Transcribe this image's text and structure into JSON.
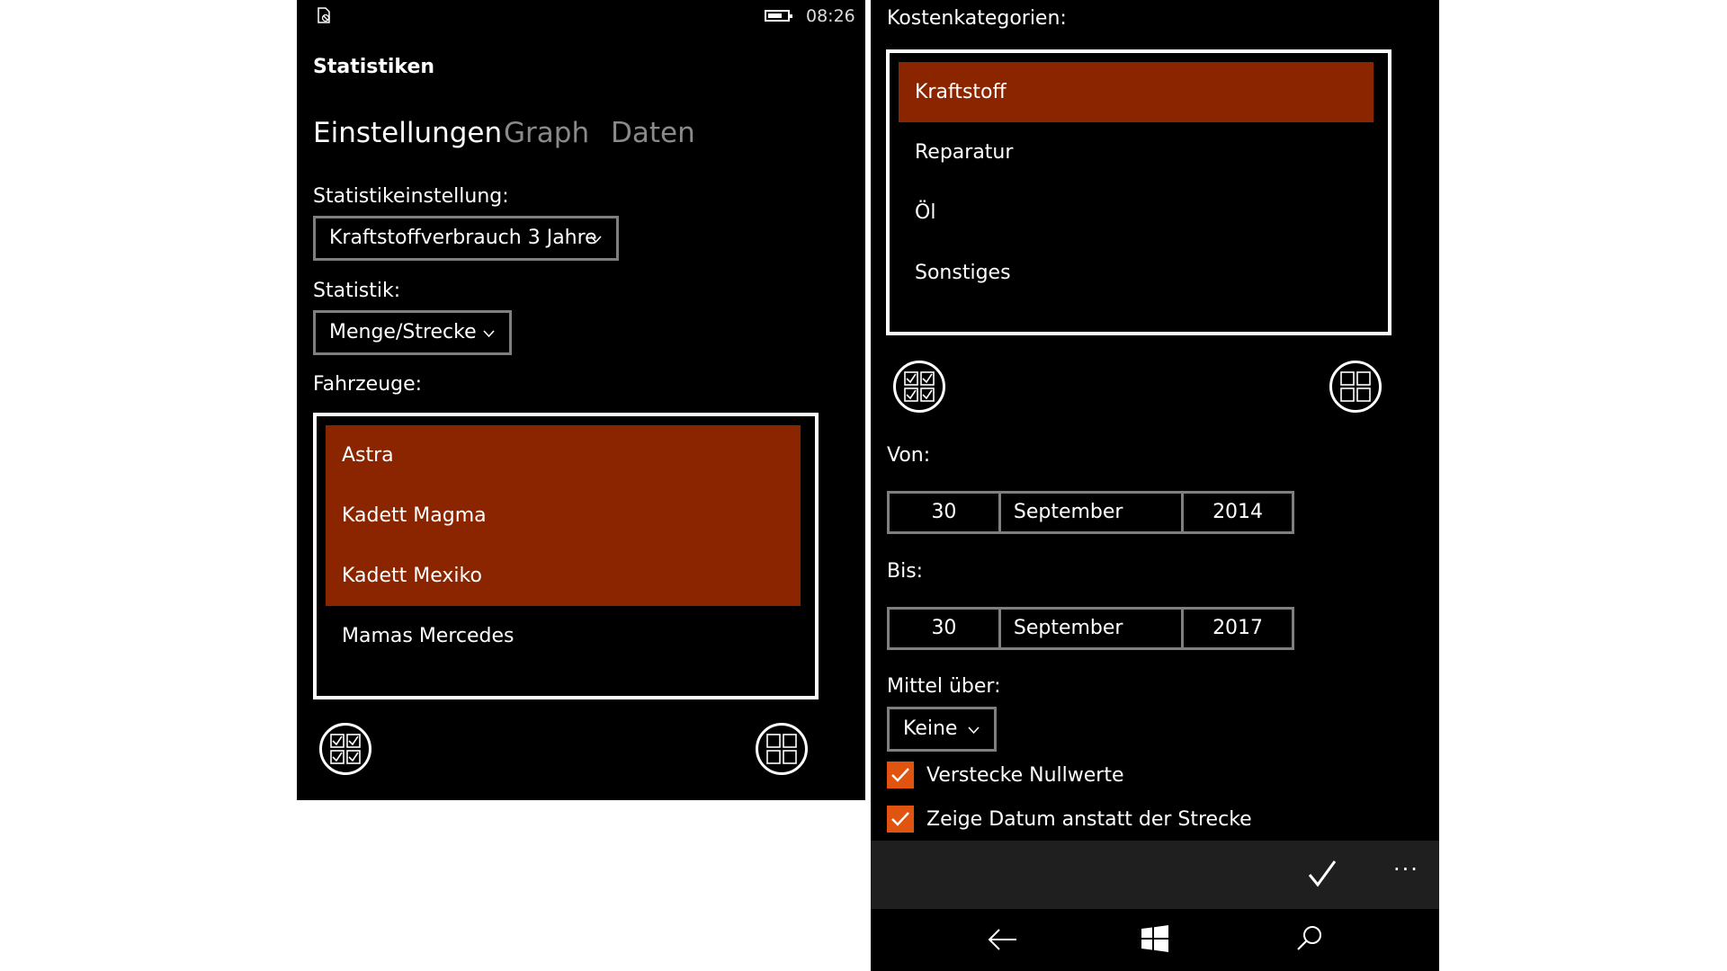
{
  "status": {
    "time": "08:26"
  },
  "left": {
    "app_title": "Statistiken",
    "pivots": [
      "Einstellungen",
      "Graph",
      "Daten"
    ],
    "settings_label": "Statistikeinstellung:",
    "settings_value": "Kraftstoffverbrauch 3 Jahre",
    "stat_label": "Statistik:",
    "stat_value": "Menge/Strecke",
    "vehicles_label": "Fahrzeuge:",
    "vehicles": [
      {
        "label": "Astra",
        "selected": true
      },
      {
        "label": "Kadett Magma",
        "selected": true
      },
      {
        "label": "Kadett Mexiko",
        "selected": true
      },
      {
        "label": "Mamas Mercedes",
        "selected": false
      }
    ]
  },
  "right": {
    "categories_label": "Kostenkategorien:",
    "categories": [
      {
        "label": "Kraftstoff",
        "selected": true
      },
      {
        "label": "Reparatur",
        "selected": false
      },
      {
        "label": "Öl",
        "selected": false
      },
      {
        "label": "Sonstiges",
        "selected": false
      }
    ],
    "from_label": "Von:",
    "from": {
      "day": "30",
      "month": "September",
      "year": "2014"
    },
    "to_label": "Bis:",
    "to": {
      "day": "30",
      "month": "September",
      "year": "2017"
    },
    "average_label": "Mittel über:",
    "average_value": "Keine",
    "hide_zero_label": "Verstecke Nullwerte",
    "hide_zero_checked": true,
    "show_date_label": "Zeige Datum anstatt der Strecke",
    "show_date_checked": true,
    "appbar_more": "···"
  },
  "colors": {
    "accent": "#e0540f",
    "selection": "#8b2500",
    "background": "#000000"
  },
  "icons": [
    "sim-icon",
    "battery-icon",
    "chevron-down-icon",
    "select-all-icon",
    "grid-icon",
    "checkmark-icon",
    "more-icon",
    "back-icon",
    "windows-icon",
    "search-icon"
  ]
}
